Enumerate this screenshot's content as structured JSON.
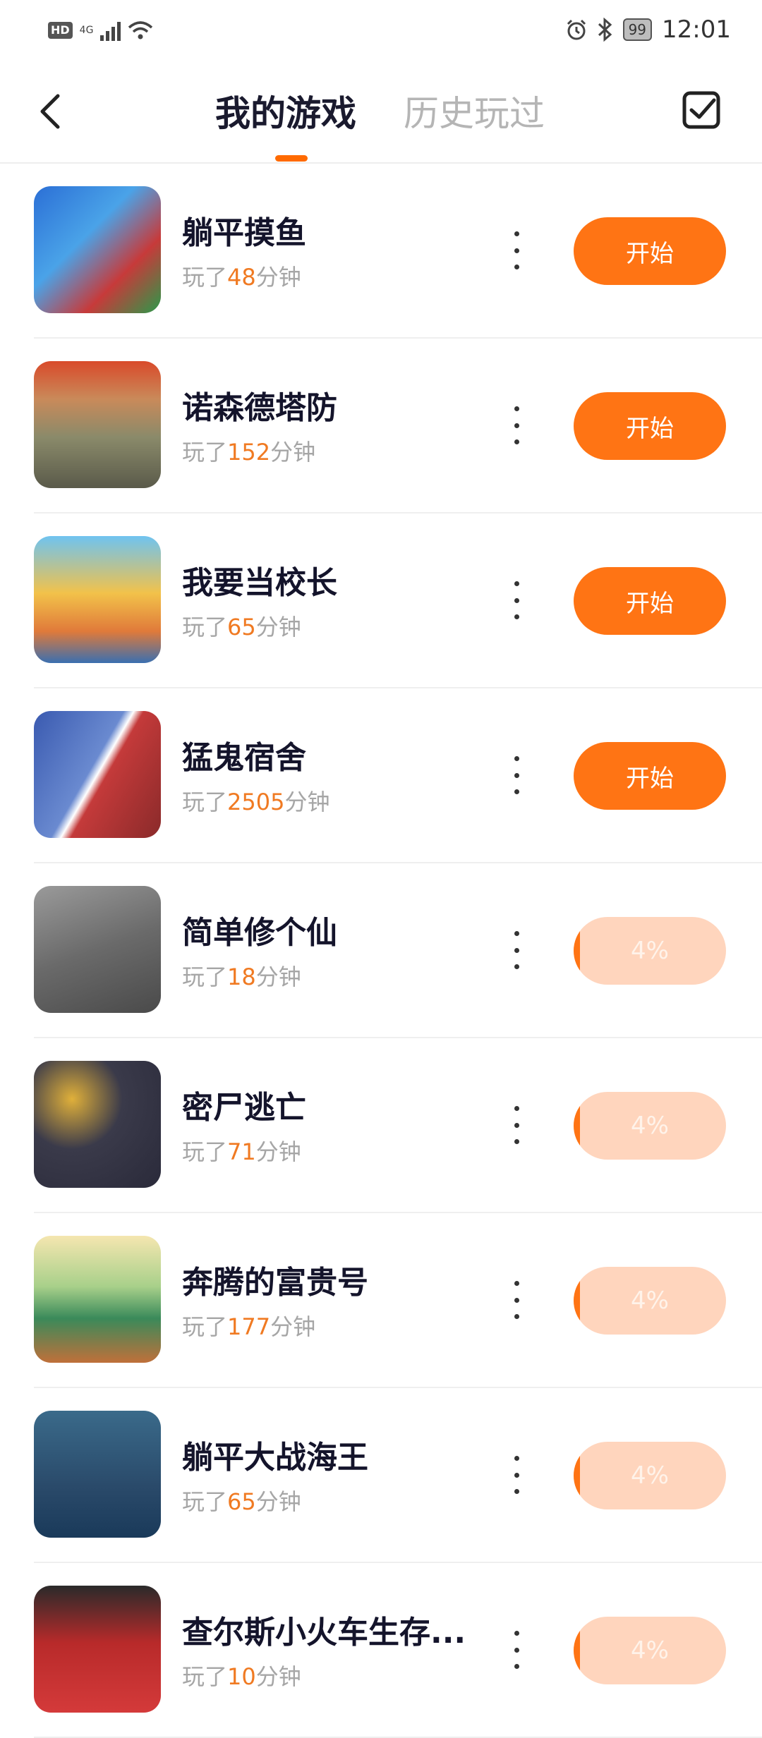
{
  "status_bar": {
    "hd": "HD",
    "network": "4G",
    "time": "12:01",
    "battery": "99",
    "icons": [
      "alarm-icon",
      "bluetooth-icon",
      "wifi-icon",
      "signal-icon"
    ]
  },
  "header": {
    "tabs": [
      {
        "label": "我的游戏",
        "active": true
      },
      {
        "label": "历史玩过",
        "active": false
      }
    ],
    "back_icon": "back-arrow-icon",
    "select_icon": "checkbox-check-icon"
  },
  "colors": {
    "accent": "#ff7414",
    "progress_bg": "#ffd5bd",
    "played_number": "#f07a22"
  },
  "games": [
    {
      "title": "躺平摸鱼",
      "prefix": "玩了",
      "minutes": "48",
      "suffix": "分钟",
      "action": "开始",
      "type": "start",
      "progress": null
    },
    {
      "title": "诺森德塔防",
      "prefix": "玩了",
      "minutes": "152",
      "suffix": "分钟",
      "action": "开始",
      "type": "start",
      "progress": null
    },
    {
      "title": "我要当校长",
      "prefix": "玩了",
      "minutes": "65",
      "suffix": "分钟",
      "action": "开始",
      "type": "start",
      "progress": null
    },
    {
      "title": "猛鬼宿舍",
      "prefix": "玩了",
      "minutes": "2505",
      "suffix": "分钟",
      "action": "开始",
      "type": "start",
      "progress": null
    },
    {
      "title": "简单修个仙",
      "prefix": "玩了",
      "minutes": "18",
      "suffix": "分钟",
      "action": "4%",
      "type": "progress",
      "progress": 0.04
    },
    {
      "title": "密尸逃亡",
      "prefix": "玩了",
      "minutes": "71",
      "suffix": "分钟",
      "action": "4%",
      "type": "progress",
      "progress": 0.04
    },
    {
      "title": "奔腾的富贵号",
      "prefix": "玩了",
      "minutes": "177",
      "suffix": "分钟",
      "action": "4%",
      "type": "progress",
      "progress": 0.04
    },
    {
      "title": "躺平大战海王",
      "prefix": "玩了",
      "minutes": "65",
      "suffix": "分钟",
      "action": "4%",
      "type": "progress",
      "progress": 0.04
    },
    {
      "title": "查尔斯小火车生存...",
      "prefix": "玩了",
      "minutes": "10",
      "suffix": "分钟",
      "action": "4%",
      "type": "progress",
      "progress": 0.04
    }
  ]
}
